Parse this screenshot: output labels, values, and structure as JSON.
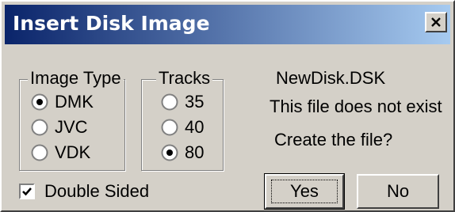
{
  "window": {
    "title": "Insert Disk Image",
    "close_icon": "close-icon"
  },
  "image_type": {
    "legend": "Image Type",
    "options": [
      {
        "label": "DMK",
        "selected": true
      },
      {
        "label": "JVC",
        "selected": false
      },
      {
        "label": "VDK",
        "selected": false
      }
    ]
  },
  "tracks": {
    "legend": "Tracks",
    "options": [
      {
        "label": "35",
        "selected": false
      },
      {
        "label": "40",
        "selected": false
      },
      {
        "label": "80",
        "selected": true
      }
    ]
  },
  "info": {
    "filename": "NewDisk.DSK",
    "status": "This file does not exist",
    "question": "Create the file?"
  },
  "double_sided": {
    "label": "Double Sided",
    "checked": true
  },
  "buttons": {
    "yes": "Yes",
    "no": "No"
  }
}
